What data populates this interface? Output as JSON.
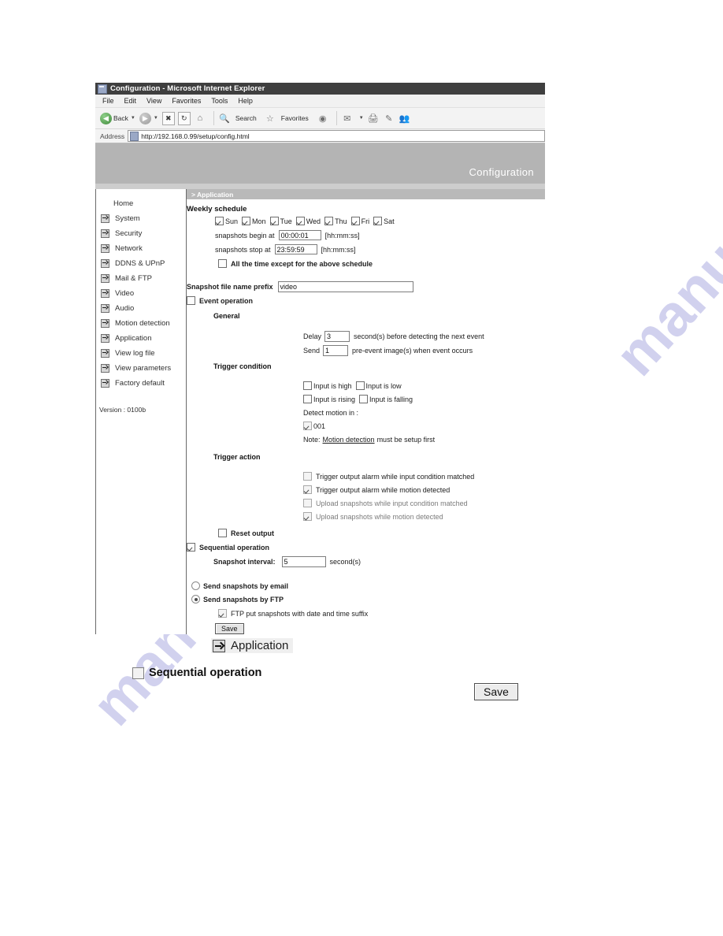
{
  "watermark": {
    "text_right": "manualshive.com",
    "text_left": "manualshive.com",
    "color": "#c9caec"
  },
  "browser": {
    "title": "Configuration - Microsoft Internet Explorer",
    "menu": [
      "File",
      "Edit",
      "View",
      "Favorites",
      "Tools",
      "Help"
    ],
    "toolbar": {
      "back_label": "Back",
      "search_label": "Search",
      "favorites_label": "Favorites",
      "icons": [
        "back-icon",
        "forward-icon",
        "stop-icon",
        "refresh-icon",
        "home-icon",
        "search-icon",
        "favorites-icon",
        "media-icon",
        "mail-icon",
        "print-icon",
        "edit-icon",
        "messenger-icon"
      ]
    },
    "address": {
      "label": "Address",
      "url": "http://192.168.0.99/setup/config.html"
    }
  },
  "page": {
    "banner_title": "Configuration",
    "section_header": "> Application",
    "version": "Version : 0100b"
  },
  "sidebar": {
    "items": [
      {
        "label": "Home",
        "has_icon": false
      },
      {
        "label": "System",
        "has_icon": true
      },
      {
        "label": "Security",
        "has_icon": true
      },
      {
        "label": "Network",
        "has_icon": true
      },
      {
        "label": "DDNS & UPnP",
        "has_icon": true
      },
      {
        "label": "Mail & FTP",
        "has_icon": true
      },
      {
        "label": "Video",
        "has_icon": true
      },
      {
        "label": "Audio",
        "has_icon": true
      },
      {
        "label": "Motion detection",
        "has_icon": true
      },
      {
        "label": "Application",
        "has_icon": true
      },
      {
        "label": "View log file",
        "has_icon": true
      },
      {
        "label": "View parameters",
        "has_icon": true
      },
      {
        "label": "Factory default",
        "has_icon": true
      }
    ]
  },
  "form": {
    "weekly_schedule_title": "Weekly schedule",
    "days": [
      {
        "label": "Sun",
        "checked": true
      },
      {
        "label": "Mon",
        "checked": true
      },
      {
        "label": "Tue",
        "checked": true
      },
      {
        "label": "Wed",
        "checked": true
      },
      {
        "label": "Thu",
        "checked": true
      },
      {
        "label": "Fri",
        "checked": true
      },
      {
        "label": "Sat",
        "checked": true
      }
    ],
    "begin_label": "snapshots begin at",
    "begin_value": "00:00:01",
    "begin_hint": "[hh:mm:ss]",
    "stop_label": "snapshots stop at",
    "stop_value": "23:59:59",
    "stop_hint": "[hh:mm:ss]",
    "all_time_label": "All the time except for the above schedule",
    "all_time_checked": false,
    "prefix_label": "Snapshot file name prefix",
    "prefix_value": "video",
    "event_operation_label": "Event operation",
    "event_operation_checked": false,
    "general_label": "General",
    "delay_prefix": "Delay",
    "delay_value": "3",
    "delay_suffix": "second(s) before detecting the next event",
    "send_prefix": "Send",
    "send_value": "1",
    "send_suffix": "pre-event image(s) when event occurs",
    "trigger_condition_label": "Trigger condition",
    "trigger_conditions": [
      {
        "label": "Input is high",
        "checked": false
      },
      {
        "label": "Input is low",
        "checked": false
      },
      {
        "label": "Input is rising",
        "checked": false
      },
      {
        "label": "Input is falling",
        "checked": false
      }
    ],
    "detect_motion_label": "Detect motion in :",
    "motion_window": {
      "label": "001",
      "checked": true
    },
    "note_prefix": "Note:",
    "note_link": "Motion detection",
    "note_suffix": "must be setup first",
    "trigger_action_label": "Trigger action",
    "trigger_actions": [
      {
        "label": "Trigger output alarm while input condition matched",
        "checked": false
      },
      {
        "label": "Trigger output alarm while motion detected",
        "checked": true
      },
      {
        "label": "Upload snapshots while input condition matched",
        "checked": false
      },
      {
        "label": "Upload snapshots while motion detected",
        "checked": true
      }
    ],
    "reset_output_label": "Reset output",
    "reset_output_checked": false,
    "sequential_operation_label": "Sequential operation",
    "sequential_operation_checked": true,
    "snapshot_interval_label": "Snapshot interval:",
    "snapshot_interval_value": "5",
    "snapshot_interval_suffix": "second(s)",
    "send_by_email_label": "Send snapshots by email",
    "send_by_ftp_label": "Send snapshots by FTP",
    "send_method_selected": "ftp",
    "ftp_suffix_label": "FTP put snapshots with date and time suffix",
    "ftp_suffix_checked": true,
    "save_label": "Save"
  },
  "callouts": {
    "application_label": "Application",
    "sequential_label": "Sequential operation",
    "sequential_checked": false,
    "save_label": "Save"
  }
}
